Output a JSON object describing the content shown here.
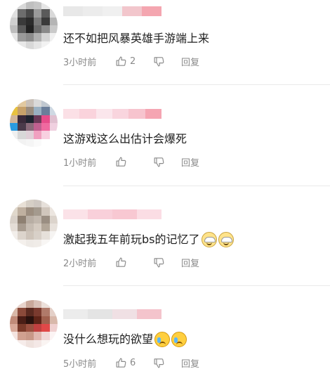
{
  "comments": [
    {
      "text": "还不如把风暴英雄手游端上来",
      "time": "3小时前",
      "likes": "2",
      "reply_label": "回复",
      "emojis": [],
      "avatar_colors": [
        "#f2f2f2",
        "#d9d9d9",
        "#bfbfbf",
        "#c6c6c6",
        "#e6e6e6",
        "#f2f2f2",
        "#e0e0e0",
        "#6d6d6d",
        "#4a4a4a",
        "#9a9a9a",
        "#5a5a5a",
        "#d9d9d9",
        "#cfcfcf",
        "#3a3a3a",
        "#2b2b2b",
        "#7a7a7a",
        "#3a3a3a",
        "#b5b5b5",
        "#bdbdbd",
        "#5a5a5a",
        "#222222",
        "#6a6a6a",
        "#8a8a8a",
        "#c9c9c9",
        "#e5e5e5",
        "#9a9a9a",
        "#8c8c8c",
        "#b0b0b0",
        "#d5d5d5",
        "#f0f0f0",
        "#f7f7f7",
        "#e8e8e8",
        "#d8d8d8",
        "#e5e5e5",
        "#f2f2f2",
        "#ffffff"
      ],
      "nick_colors": [
        "#e8e8e8",
        "#ececec",
        "#f0f0f0",
        "#f2c6cc",
        "#f4a6b0"
      ]
    },
    {
      "text": "这游戏这么出估计会爆死",
      "time": "1小时前",
      "likes": "",
      "reply_label": "回复",
      "emojis": [],
      "avatar_colors": [
        "#f5f5f5",
        "#e2c9a0",
        "#c9c0b8",
        "#d9d9d9",
        "#c0c8d0",
        "#f5f5f5",
        "#e8c240",
        "#c7a16a",
        "#9a8c7e",
        "#9ab0c2",
        "#6a7e9a",
        "#cfd9e3",
        "#d0b49a",
        "#3a2a3a",
        "#1f2430",
        "#6b3a58",
        "#e74c8a",
        "#e0c0d0",
        "#2a9be0",
        "#4a3a4a",
        "#8a6a7a",
        "#c06090",
        "#f06aa0",
        "#f0d0e0",
        "#f0f0f0",
        "#d8d8d8",
        "#e0d0d8",
        "#f0a0c0",
        "#f8d0e0",
        "#ffffff",
        "#ffffff",
        "#f2f2f2",
        "#f5f5f5",
        "#fafafa",
        "#ffffff",
        "#ffffff"
      ],
      "nick_colors": [
        "#fbe0e6",
        "#fad3dc",
        "#fbe6ec",
        "#f9d5de",
        "#f7c4ce",
        "#f5a5b2"
      ]
    },
    {
      "text": "激起我五年前玩bs的记忆了",
      "time": "2小时前",
      "likes": "",
      "reply_label": "回复",
      "emojis": [
        "hat",
        "hat"
      ],
      "avatar_colors": [
        "#f7f7f7",
        "#e8e0d6",
        "#d6cfc6",
        "#cfc8c2",
        "#e6e0da",
        "#f7f7f7",
        "#e0d8cc",
        "#bfb0a0",
        "#9c8e80",
        "#a49a8e",
        "#d0c6bc",
        "#ece6e0",
        "#d8d0c8",
        "#8e8072",
        "#b8aea4",
        "#c2b8ae",
        "#9a8e82",
        "#dcd4cc",
        "#e4ddd6",
        "#a89c90",
        "#c6bcb2",
        "#d4cac0",
        "#b2a698",
        "#e8e2dc",
        "#f2eeea",
        "#dcd4cc",
        "#cec4ba",
        "#d8d0c8",
        "#e6e0da",
        "#f6f4f2",
        "#ffffff",
        "#f4f0ec",
        "#eeeae6",
        "#f0ece8",
        "#f8f6f4",
        "#ffffff"
      ],
      "nick_colors": [
        "#fbe2e8",
        "#f9d0da",
        "#f8c8d2",
        "#fbdde4"
      ]
    },
    {
      "text": "没什么想玩的欲望",
      "time": "5小时前",
      "likes": "6",
      "reply_label": "回复",
      "emojis": [
        "cry",
        "cry"
      ],
      "avatar_colors": [
        "#f4f0ee",
        "#e8d4cc",
        "#c9a89a",
        "#d8c0b6",
        "#ece0da",
        "#f8f4f2",
        "#d8b8a8",
        "#8a4a3a",
        "#5a2a20",
        "#7a3a2e",
        "#b07a6a",
        "#e4d0c8",
        "#c08a78",
        "#4a1e16",
        "#2a120e",
        "#5e2418",
        "#a0604e",
        "#d8b8aa",
        "#d8a898",
        "#7a3a2a",
        "#9a5040",
        "#c04040",
        "#e04848",
        "#f0d0d0",
        "#f4e4e0",
        "#d0a090",
        "#c89888",
        "#e0b8b0",
        "#f0d8d8",
        "#fcf4f4",
        "#ffffff",
        "#f6ecea",
        "#efe2de",
        "#f4e8e6",
        "#faf4f2",
        "#ffffff"
      ],
      "nick_colors": [
        "#ececec",
        "#e4e4e4",
        "#f0e0e4",
        "#f4c4cc"
      ]
    }
  ]
}
